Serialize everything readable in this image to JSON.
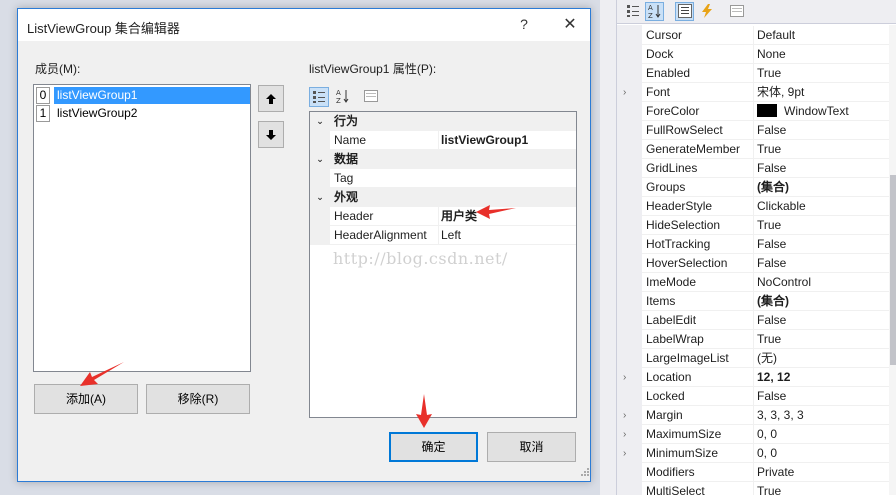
{
  "dialog": {
    "title": "ListViewGroup 集合编辑器",
    "help_glyph": "?",
    "close_glyph": "✕",
    "members_label": "成员(M):",
    "members": [
      {
        "index": "0",
        "name": "listViewGroup1",
        "selected": true
      },
      {
        "index": "1",
        "name": "listViewGroup2",
        "selected": false
      }
    ],
    "move_up_glyph": "🡅",
    "move_down_glyph": "🡇",
    "props_label": "listViewGroup1 属性(P):",
    "property_grid": [
      {
        "type": "category",
        "name": "行为"
      },
      {
        "type": "prop",
        "name": "Name",
        "value": "listViewGroup1",
        "bold": true
      },
      {
        "type": "category",
        "name": "数据"
      },
      {
        "type": "prop",
        "name": "Tag",
        "value": "",
        "bold": false
      },
      {
        "type": "category",
        "name": "外观"
      },
      {
        "type": "prop",
        "name": "Header",
        "value": "用户类",
        "bold": true
      },
      {
        "type": "prop",
        "name": "HeaderAlignment",
        "value": "Left",
        "bold": false
      }
    ],
    "add_label": "添加(A)",
    "remove_label": "移除(R)",
    "ok_label": "确定",
    "cancel_label": "取消"
  },
  "watermark": "http://blog.csdn.net/",
  "properties_window": {
    "rows": [
      {
        "name": "Cursor",
        "value": "Default",
        "expandable": false,
        "bold": false
      },
      {
        "name": "Dock",
        "value": "None",
        "expandable": false,
        "bold": false
      },
      {
        "name": "Enabled",
        "value": "True",
        "expandable": false,
        "bold": false
      },
      {
        "name": "Font",
        "value": "宋体, 9pt",
        "expandable": true,
        "bold": false
      },
      {
        "name": "ForeColor",
        "value": "WindowText",
        "expandable": false,
        "bold": false,
        "swatch": "#000000"
      },
      {
        "name": "FullRowSelect",
        "value": "False",
        "expandable": false,
        "bold": false
      },
      {
        "name": "GenerateMember",
        "value": "True",
        "expandable": false,
        "bold": false
      },
      {
        "name": "GridLines",
        "value": "False",
        "expandable": false,
        "bold": false
      },
      {
        "name": "Groups",
        "value": "(集合)",
        "expandable": false,
        "bold": true
      },
      {
        "name": "HeaderStyle",
        "value": "Clickable",
        "expandable": false,
        "bold": false
      },
      {
        "name": "HideSelection",
        "value": "True",
        "expandable": false,
        "bold": false
      },
      {
        "name": "HotTracking",
        "value": "False",
        "expandable": false,
        "bold": false
      },
      {
        "name": "HoverSelection",
        "value": "False",
        "expandable": false,
        "bold": false
      },
      {
        "name": "ImeMode",
        "value": "NoControl",
        "expandable": false,
        "bold": false
      },
      {
        "name": "Items",
        "value": "(集合)",
        "expandable": false,
        "bold": true
      },
      {
        "name": "LabelEdit",
        "value": "False",
        "expandable": false,
        "bold": false
      },
      {
        "name": "LabelWrap",
        "value": "True",
        "expandable": false,
        "bold": false
      },
      {
        "name": "LargeImageList",
        "value": "(无)",
        "expandable": false,
        "bold": false
      },
      {
        "name": "Location",
        "value": "12, 12",
        "expandable": true,
        "bold": true
      },
      {
        "name": "Locked",
        "value": "False",
        "expandable": false,
        "bold": false
      },
      {
        "name": "Margin",
        "value": "3, 3, 3, 3",
        "expandable": true,
        "bold": false
      },
      {
        "name": "MaximumSize",
        "value": "0, 0",
        "expandable": true,
        "bold": false
      },
      {
        "name": "MinimumSize",
        "value": "0, 0",
        "expandable": true,
        "bold": false
      },
      {
        "name": "Modifiers",
        "value": "Private",
        "expandable": false,
        "bold": false
      },
      {
        "name": "MultiSelect",
        "value": "True",
        "expandable": false,
        "bold": false
      }
    ]
  },
  "colors": {
    "selection": "#3399ff",
    "accent_border": "#0078d7",
    "annotation_arrow": "#e8302a"
  }
}
